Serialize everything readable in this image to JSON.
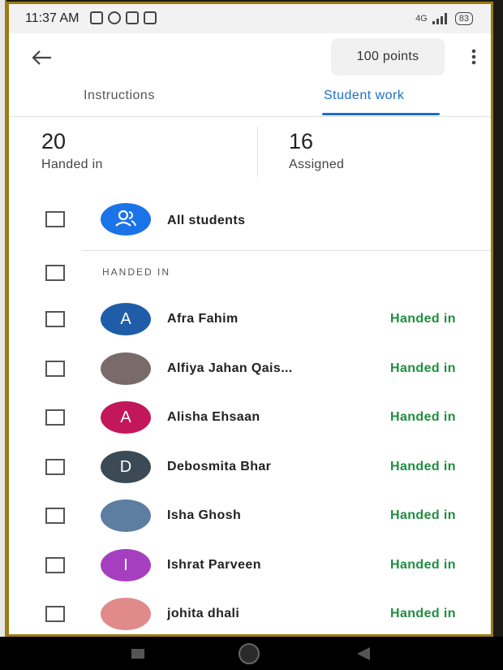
{
  "status_bar": {
    "time": "11:37 AM",
    "network": "4G",
    "battery": "83"
  },
  "app_bar": {
    "points": "100 points"
  },
  "tabs": [
    {
      "label": "Instructions"
    },
    {
      "label": "Student work"
    }
  ],
  "stats": {
    "handed_in": {
      "value": "20",
      "label": "Handed in"
    },
    "assigned": {
      "value": "16",
      "label": "Assigned"
    }
  },
  "all_students_label": "All students",
  "section_label": "HANDED IN",
  "students": [
    {
      "name": "Afra Fahim",
      "initial": "A",
      "avatar_color": "#1f5da8",
      "status": "Handed in"
    },
    {
      "name": "Alfiya Jahan Qais...",
      "initial": "",
      "avatar_color": "#7a6a6a",
      "status": "Handed in"
    },
    {
      "name": "Alisha Ehsaan",
      "initial": "A",
      "avatar_color": "#c2185b",
      "status": "Handed in"
    },
    {
      "name": "Debosmita Bhar",
      "initial": "D",
      "avatar_color": "#3b4a55",
      "status": "Handed in"
    },
    {
      "name": "Isha Ghosh",
      "initial": "",
      "avatar_color": "#5c7ea0",
      "status": "Handed in"
    },
    {
      "name": "Ishrat Parveen",
      "initial": "I",
      "avatar_color": "#a63fbf",
      "status": "Handed in"
    },
    {
      "name": "johita dhali",
      "initial": "",
      "avatar_color": "#e08a8a",
      "status": "Handed in"
    }
  ],
  "colors": {
    "accent": "#1a6fce",
    "handed_in": "#1e8e3e",
    "all_students_avatar": "#1a73e8"
  }
}
